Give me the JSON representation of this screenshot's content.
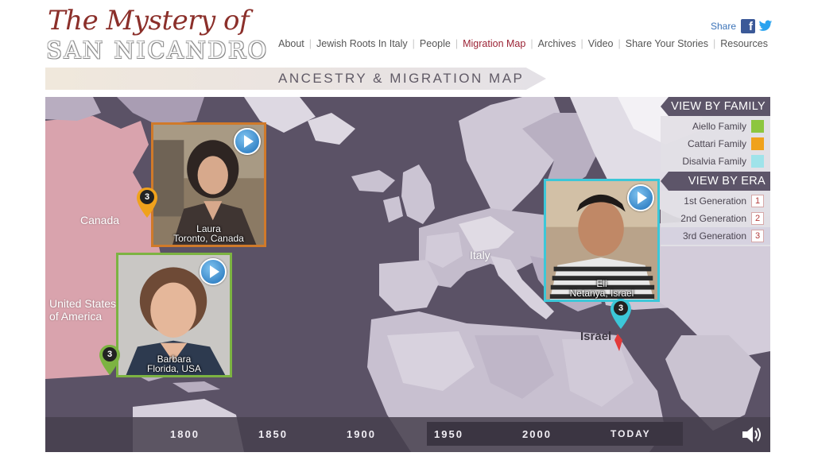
{
  "logo": {
    "line1": "The Mystery of",
    "line2": "SAN NICANDRO"
  },
  "share": {
    "label": "Share",
    "facebook_icon": "facebook-icon",
    "twitter_icon": "twitter-icon"
  },
  "nav": {
    "items": [
      {
        "label": "About"
      },
      {
        "label": "Jewish Roots In Italy"
      },
      {
        "label": "People"
      },
      {
        "label": "Migration Map",
        "active": true
      },
      {
        "label": "Archives"
      },
      {
        "label": "Video"
      },
      {
        "label": "Share Your Stories"
      },
      {
        "label": "Resources"
      }
    ]
  },
  "banner": {
    "title": "ANCESTRY & MIGRATION MAP"
  },
  "map": {
    "labels": {
      "canada": "Canada",
      "usa": "United States\nof America",
      "italy": "Italy",
      "israel": "Israel"
    },
    "cards": [
      {
        "name": "Laura",
        "place": "Toronto, Canada",
        "color": "#d07a2a",
        "pin_count": "3",
        "pin_color": "#f0a21c"
      },
      {
        "name": "Barbara",
        "place": "Florida, USA",
        "color": "#7cb342",
        "pin_count": "3",
        "pin_color": "#7cb342"
      },
      {
        "name": "Eli",
        "place": "Netanya, Israel",
        "color": "#3cc7d8",
        "pin_count": "3",
        "pin_color": "#3cc7d8"
      }
    ]
  },
  "panel": {
    "family_heading": "VIEW BY FAMILY",
    "families": [
      {
        "label": "Aiello Family",
        "color": "#8dc63f"
      },
      {
        "label": "Cattari Family",
        "color": "#f0a21c"
      },
      {
        "label": "Disalvia Family",
        "color": "#9fe3ea"
      }
    ],
    "era_heading": "VIEW BY ERA",
    "eras": [
      {
        "label": "1st Generation",
        "num": "1"
      },
      {
        "label": "2nd Generation",
        "num": "2"
      },
      {
        "label": "3rd Generation",
        "num": "3",
        "selected": true
      }
    ]
  },
  "timeline": {
    "labels": [
      "1800",
      "1850",
      "1900",
      "1950",
      "2000",
      "TODAY"
    ],
    "speaker_icon": "speaker-icon"
  }
}
